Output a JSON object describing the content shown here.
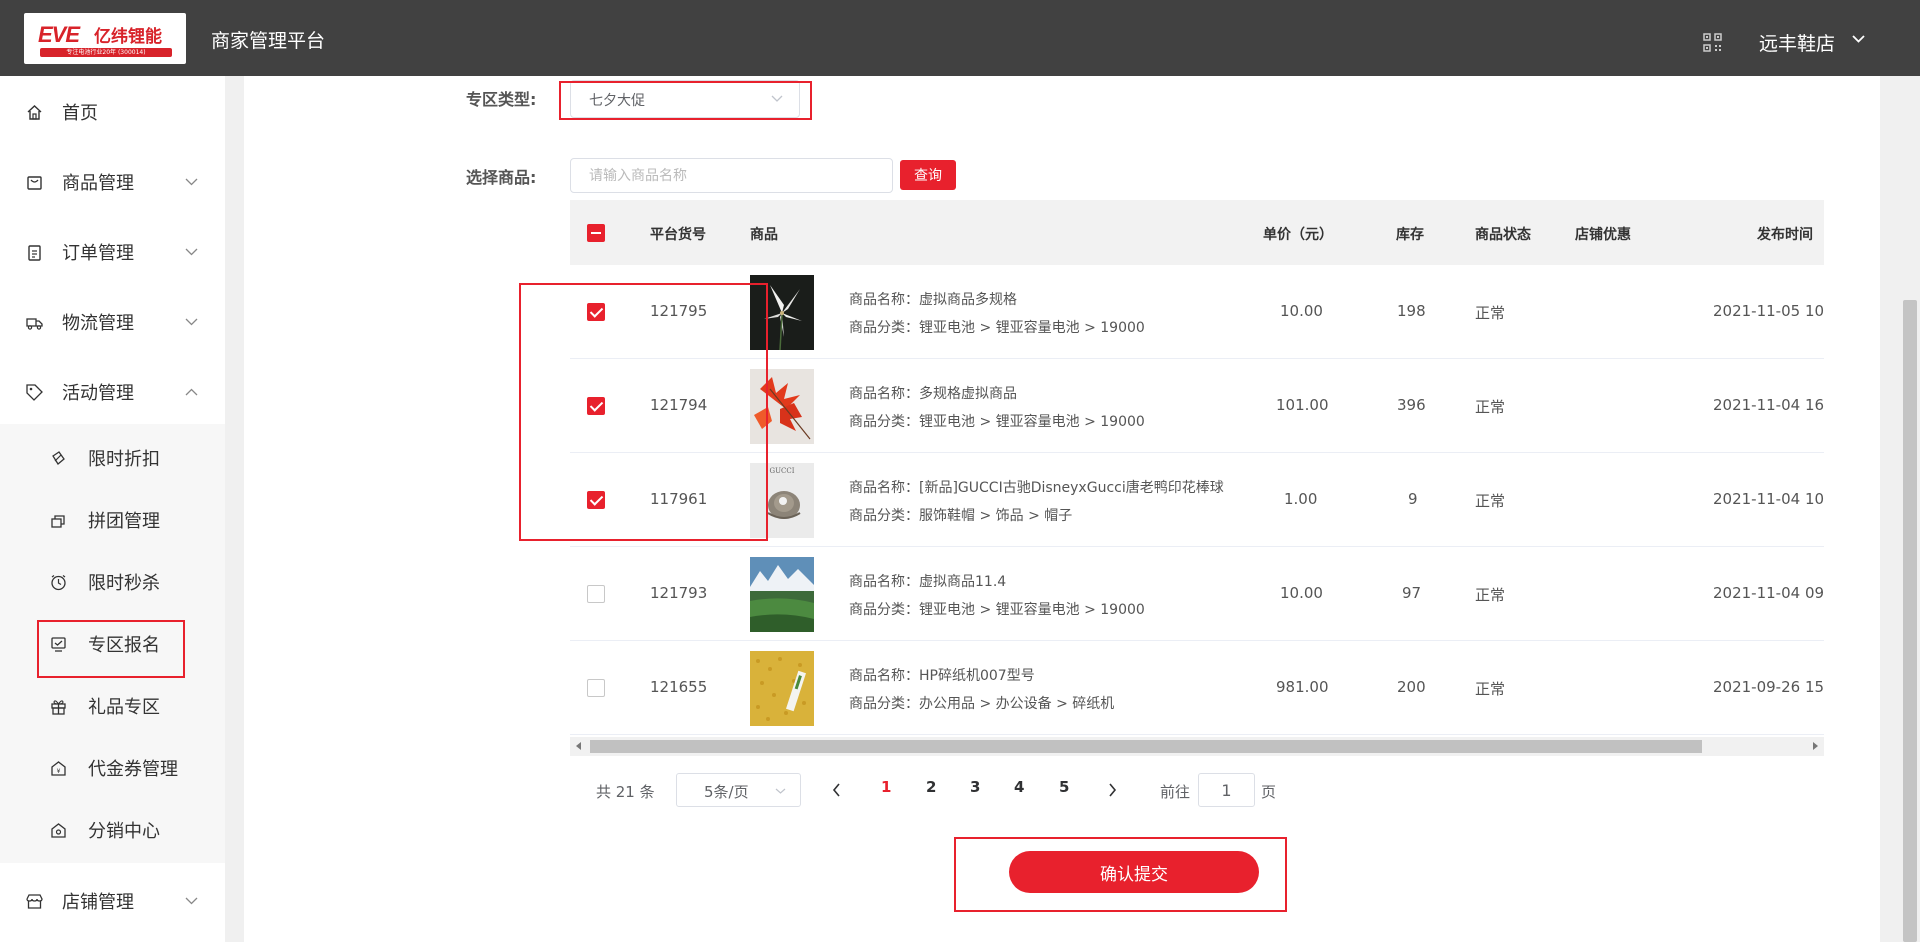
{
  "header": {
    "logo_text": "EVE",
    "logo_cn": "亿纬锂能",
    "logo_sub": "专注电池行业20年 (300014)",
    "platform_title": "商家管理平台",
    "qr_icon": "qr-code-icon",
    "shop_name": "远丰鞋店"
  },
  "sidebar": {
    "items": [
      {
        "label": "首页",
        "icon": "home-icon"
      },
      {
        "label": "商品管理",
        "icon": "goods-icon"
      },
      {
        "label": "订单管理",
        "icon": "order-icon"
      },
      {
        "label": "物流管理",
        "icon": "truck-icon"
      },
      {
        "label": "活动管理",
        "icon": "tag-icon"
      },
      {
        "label": "店铺管理",
        "icon": "shop-icon"
      }
    ],
    "sub_items": [
      {
        "label": "限时折扣",
        "icon": "discount-icon"
      },
      {
        "label": "拼团管理",
        "icon": "group-icon"
      },
      {
        "label": "限时秒杀",
        "icon": "clock-icon"
      },
      {
        "label": "专区报名",
        "icon": "zone-icon"
      },
      {
        "label": "礼品专区",
        "icon": "gift-icon"
      },
      {
        "label": "代金券管理",
        "icon": "coupon-icon"
      },
      {
        "label": "分销中心",
        "icon": "distribution-icon"
      }
    ]
  },
  "form": {
    "zone_type_label": "专区类型:",
    "zone_type_value": "七夕大促",
    "select_goods_label": "选择商品:",
    "search_placeholder": "请输入商品名称",
    "query_label": "查询"
  },
  "table": {
    "headers": [
      "平台货号",
      "商品",
      "单价（元）",
      "库存",
      "商品状态",
      "店铺优惠",
      "发布时间"
    ],
    "rows": [
      {
        "checked": true,
        "sku": "121795",
        "name": "商品名称：虚拟商品多规格",
        "category": "商品分类：锂亚电池 > 锂亚容量电池 > 19000",
        "price": "10.00",
        "stock": "198",
        "status": "正常",
        "time": "2021-11-05 10:",
        "thumb": "white-flower"
      },
      {
        "checked": true,
        "sku": "121794",
        "name": "商品名称：多规格虚拟商品",
        "category": "商品分类：锂亚电池 > 锂亚容量电池 > 19000",
        "price": "101.00",
        "stock": "396",
        "status": "正常",
        "time": "2021-11-04 16:",
        "thumb": "red-leaves"
      },
      {
        "checked": true,
        "sku": "117961",
        "name": "商品名称：[新品]GUCCI古驰DisneyxGucci唐老鸭印花棒球",
        "category": "商品分类：服饰鞋帽 > 饰品 > 帽子",
        "price": "1.00",
        "stock": "9",
        "status": "正常",
        "time": "2021-11-04 10:",
        "thumb": "gucci-cap",
        "thumb_text": "GUCCI"
      },
      {
        "checked": false,
        "sku": "121793",
        "name": "商品名称：虚拟商品11.4",
        "category": "商品分类：锂亚电池 > 锂亚容量电池 > 19000",
        "price": "10.00",
        "stock": "97",
        "status": "正常",
        "time": "2021-11-04 09:",
        "thumb": "mountain"
      },
      {
        "checked": false,
        "sku": "121655",
        "name": "商品名称：HP碎纸机007型号",
        "category": "商品分类：办公用品 > 办公设备 > 碎纸机",
        "price": "981.00",
        "stock": "200",
        "status": "正常",
        "time": "2021-09-26 15:",
        "thumb": "wheat"
      }
    ]
  },
  "pagination": {
    "total": "共 21 条",
    "page_size": "5条/页",
    "pages": [
      "1",
      "2",
      "3",
      "4",
      "5"
    ],
    "active_page": "1",
    "goto_label": "前往",
    "goto_value": "1",
    "page_unit": "页"
  },
  "submit_label": "确认提交",
  "colors": {
    "accent": "#e8212d",
    "header_bg": "#414141"
  }
}
